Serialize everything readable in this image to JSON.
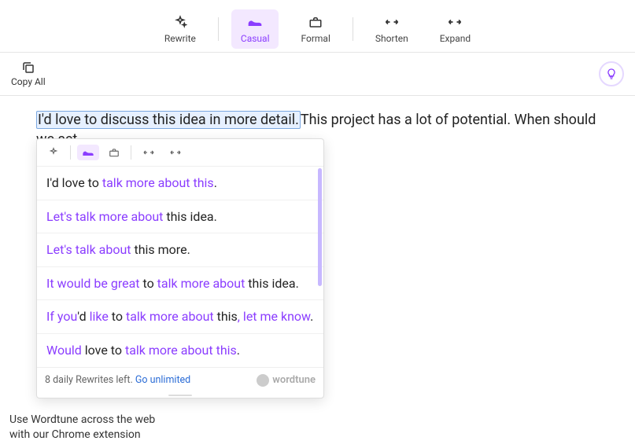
{
  "toolbar": {
    "rewrite": "Rewrite",
    "casual": "Casual",
    "formal": "Formal",
    "shorten": "Shorten",
    "expand": "Expand"
  },
  "actionbar": {
    "copy_all": "Copy All"
  },
  "content": {
    "highlighted": "I'd love to discuss this idea in more detail.",
    "rest": "This project has a lot of potential. When should we set"
  },
  "suggestions": [
    [
      {
        "t": "I'd love to ",
        "hl": false
      },
      {
        "t": "talk more about this",
        "hl": true
      },
      {
        "t": ".",
        "hl": false
      }
    ],
    [
      {
        "t": "Let's",
        "hl": true
      },
      {
        "t": " ",
        "hl": false
      },
      {
        "t": "talk more about",
        "hl": true
      },
      {
        "t": " this idea.",
        "hl": false
      }
    ],
    [
      {
        "t": "Let's",
        "hl": true
      },
      {
        "t": " ",
        "hl": false
      },
      {
        "t": "talk about",
        "hl": true
      },
      {
        "t": " this more.",
        "hl": false
      }
    ],
    [
      {
        "t": "It would be great",
        "hl": true
      },
      {
        "t": " to ",
        "hl": false
      },
      {
        "t": "talk more about",
        "hl": true
      },
      {
        "t": " this idea.",
        "hl": false
      }
    ],
    [
      {
        "t": "If you",
        "hl": true
      },
      {
        "t": "'d ",
        "hl": false
      },
      {
        "t": "like",
        "hl": true
      },
      {
        "t": " to ",
        "hl": false
      },
      {
        "t": "talk more about",
        "hl": true
      },
      {
        "t": " this",
        "hl": false
      },
      {
        "t": ",",
        "hl": true
      },
      {
        "t": " ",
        "hl": false
      },
      {
        "t": "let me know",
        "hl": true
      },
      {
        "t": ".",
        "hl": false
      }
    ],
    [
      {
        "t": "Would",
        "hl": true
      },
      {
        "t": " love to ",
        "hl": false
      },
      {
        "t": "talk more about this",
        "hl": true
      },
      {
        "t": ".",
        "hl": false
      }
    ]
  ],
  "popup_footer": {
    "rewrites_left": "8 daily Rewrites left. ",
    "go_unlimited": "Go unlimited",
    "brand": "wordtune"
  },
  "footer_note": {
    "line1": "Use Wordtune across the web",
    "line2": "with our Chrome extension"
  },
  "colors": {
    "accent": "#8b3dff"
  }
}
